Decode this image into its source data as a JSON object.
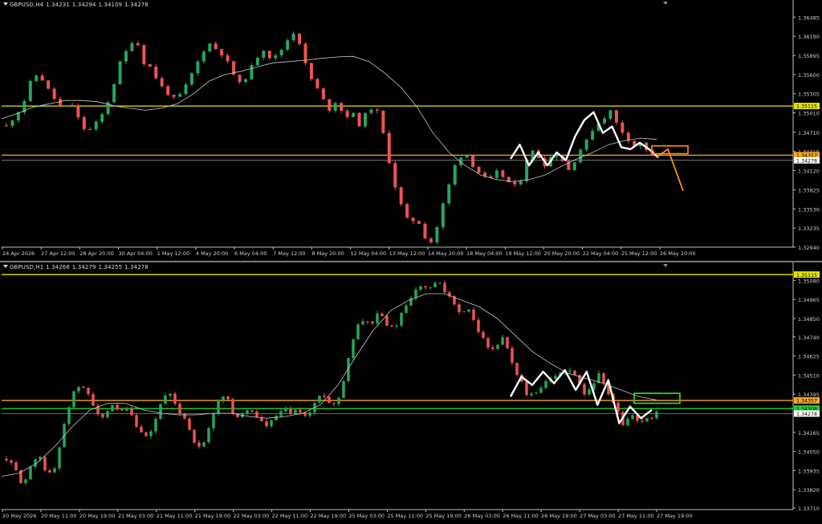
{
  "colors": {
    "background": "#000000",
    "bull": "#26a65b",
    "bear": "#ef5350",
    "ma_line": "#c8c8c8",
    "axis": "#bfbfbf",
    "resistance": "#e6e600",
    "orange_level": "#f5a623",
    "green_level": "#1fcf3a",
    "zigzag": "#ffffff",
    "projection": "#ff8c1a",
    "zone_green": "#2ee82e"
  },
  "chart_data": [
    {
      "type": "candlestick",
      "symbol": "GBPUSD,H4",
      "ohlc": {
        "open": "1.34231",
        "high": "1.34294",
        "low": "1.34109",
        "close": "1.34278"
      },
      "ylim": [
        1.3294,
        1.366
      ],
      "y_ticks": [
        "1.36485",
        "1.36190",
        "1.35895",
        "1.35600",
        "1.35305",
        "1.35010",
        "1.34710",
        "1.34415",
        "1.34120",
        "1.33825",
        "1.33530",
        "1.33235",
        "1.32940"
      ],
      "x_ticks": [
        "24 Apr 2026",
        "27 Apr 12:00",
        "28 Apr 20:00",
        "30 Apr 04:00",
        "1 May 12:00",
        "4 May 20:00",
        "6 May 04:00",
        "7 May 12:00",
        "8 May 20:00",
        "12 May 04:00",
        "13 May 12:00",
        "14 May 20:00",
        "18 May 04:00",
        "19 May 12:00",
        "20 May 20:00",
        "22 May 04:00",
        "25 May 12:00",
        "26 May 20:00"
      ],
      "levels": [
        {
          "value": 1.35115,
          "label": "1.35115",
          "color": "yellow"
        },
        {
          "value": 1.34357,
          "label": "1.34357",
          "color": "orange"
        },
        {
          "value": 1.34278,
          "label": "1.34278",
          "color": "gray"
        }
      ],
      "close_path": [
        1.348,
        1.3496,
        1.3512,
        1.3548,
        1.3563,
        1.354,
        1.3522,
        1.3505,
        1.3518,
        1.349,
        1.347,
        1.3482,
        1.35,
        1.353,
        1.3575,
        1.3598,
        1.362,
        1.358,
        1.357,
        1.3545,
        1.3532,
        1.352,
        1.3535,
        1.356,
        1.3585,
        1.361,
        1.36,
        1.359,
        1.3565,
        1.3545,
        1.356,
        1.3585,
        1.36,
        1.3582,
        1.3595,
        1.3615,
        1.363,
        1.358,
        1.355,
        1.353,
        1.3505,
        1.352,
        1.3495,
        1.35,
        1.348,
        1.351,
        1.3505,
        1.346,
        1.34,
        1.336,
        1.333,
        1.334,
        1.331,
        1.33,
        1.335,
        1.339,
        1.343,
        1.344,
        1.342,
        1.3405,
        1.3395,
        1.341,
        1.34,
        1.3385,
        1.34,
        1.3445,
        1.3435,
        1.342,
        1.344,
        1.343,
        1.341,
        1.344,
        1.3455,
        1.348,
        1.349,
        1.3505,
        1.348,
        1.3465,
        1.345,
        1.3455,
        1.3435,
        1.3428
      ],
      "ma_path": [
        1.3492,
        1.35,
        1.351,
        1.3515,
        1.352,
        1.352,
        1.3518,
        1.3512,
        1.3508,
        1.3505,
        1.3508,
        1.3515,
        1.353,
        1.355,
        1.356,
        1.3565,
        1.3572,
        1.3578,
        1.358,
        1.3582,
        1.3585,
        1.3587,
        1.3588,
        1.358,
        1.3562,
        1.354,
        1.351,
        1.347,
        1.344,
        1.342,
        1.3405,
        1.3398,
        1.3395,
        1.3398,
        1.3405,
        1.3418,
        1.343,
        1.344,
        1.3452,
        1.3458,
        1.3462,
        1.346
      ],
      "zigzag": [
        1.343,
        1.3452,
        1.342,
        1.344,
        1.342,
        1.344,
        1.3428,
        1.3465,
        1.349,
        1.3502,
        1.347,
        1.348,
        1.3448,
        1.3445,
        1.3455,
        1.3445,
        1.3432
      ],
      "zone": {
        "low": 1.3438,
        "high": 1.345
      },
      "projection": [
        1.34357,
        1.3445,
        1.3381
      ]
    },
    {
      "type": "candlestick",
      "symbol": "GBPUSD,H1",
      "ohlc": {
        "open": "1.34266",
        "high": "1.34279",
        "low": "1.34255",
        "close": "1.34278"
      },
      "ylim": [
        1.337,
        1.3514
      ],
      "y_ticks": [
        "1.35080",
        "1.34965",
        "1.34850",
        "1.34740",
        "1.34625",
        "1.34510",
        "1.34395",
        "1.34165",
        "1.34050",
        "1.33935",
        "1.33820",
        "1.33710"
      ],
      "x_ticks": [
        "20 May 2026",
        "20 May 11:00",
        "20 May 19:00",
        "21 May 03:00",
        "21 May 11:00",
        "21 May 19:00",
        "22 May 03:00",
        "22 May 11:00",
        "22 May 19:00",
        "25 May 03:00",
        "25 May 11:00",
        "25 May 19:00",
        "26 May 03:00",
        "26 May 11:00",
        "26 May 19:00",
        "27 May 03:00",
        "27 May 11:00",
        "27 May 19:00"
      ],
      "levels": [
        {
          "value": 1.35115,
          "label": "1.35115",
          "color": "yellow"
        },
        {
          "value": 1.34357,
          "label": "1.34357",
          "color": "orange"
        },
        {
          "value": 1.34308,
          "label": "1.34308",
          "color": "green"
        },
        {
          "value": 1.34278,
          "label": "1.34278",
          "color": "gray"
        }
      ],
      "close_path": [
        1.34,
        1.3395,
        1.3385,
        1.3395,
        1.3405,
        1.339,
        1.3395,
        1.342,
        1.3438,
        1.3445,
        1.344,
        1.343,
        1.3425,
        1.3432,
        1.3428,
        1.343,
        1.342,
        1.3412,
        1.3418,
        1.3435,
        1.344,
        1.343,
        1.3425,
        1.3412,
        1.3405,
        1.342,
        1.3435,
        1.344,
        1.3425,
        1.3428,
        1.343,
        1.3425,
        1.342,
        1.3425,
        1.343,
        1.3428,
        1.343,
        1.3425,
        1.3435,
        1.344,
        1.3432,
        1.3438,
        1.346,
        1.348,
        1.3485,
        1.3482,
        1.349,
        1.3478,
        1.3482,
        1.3492,
        1.35,
        1.3505,
        1.3502,
        1.3508,
        1.35,
        1.3495,
        1.3488,
        1.349,
        1.3478,
        1.347,
        1.3465,
        1.3475,
        1.3462,
        1.345,
        1.344,
        1.3438,
        1.3445,
        1.3448,
        1.3452,
        1.3455,
        1.345,
        1.344,
        1.3445,
        1.3452,
        1.344,
        1.3432,
        1.342,
        1.3428,
        1.3422,
        1.3425,
        1.3428
      ],
      "ma_path": [
        1.339,
        1.3392,
        1.3398,
        1.3408,
        1.342,
        1.343,
        1.3434,
        1.3434,
        1.343,
        1.3428,
        1.3427,
        1.3427,
        1.3428,
        1.3428,
        1.3426,
        1.3425,
        1.3426,
        1.3428,
        1.3433,
        1.3445,
        1.3462,
        1.3478,
        1.349,
        1.3496,
        1.35,
        1.35,
        1.3496,
        1.3492,
        1.3485,
        1.3475,
        1.3465,
        1.3458,
        1.3452,
        1.3449,
        1.3446,
        1.3442,
        1.3438,
        1.3436
      ],
      "zigzag": [
        1.3438,
        1.345,
        1.3445,
        1.3453,
        1.3446,
        1.3454,
        1.3442,
        1.3453,
        1.3433,
        1.3448,
        1.3422,
        1.3432,
        1.3425,
        1.343
      ],
      "zone": {
        "low": 1.3434,
        "high": 1.344
      }
    }
  ]
}
